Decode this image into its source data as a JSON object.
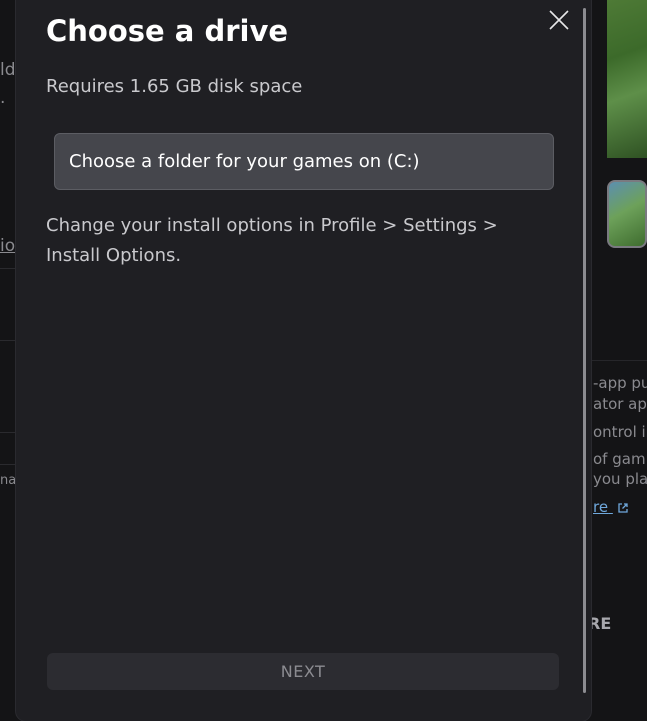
{
  "dialog": {
    "title": "Choose a drive",
    "space_requirement": "Requires 1.65 GB disk space",
    "folder_option": "Choose a folder for your games on (C:)",
    "info": "Change your install options in Profile > Settings > Install Options.",
    "next_label": "NEXT",
    "close_icon": "close-icon"
  },
  "background": {
    "left_fragments": [
      "ld",
      "io",
      "na"
    ],
    "right_fragments": [
      "-app pu",
      "ator app",
      "ontrol in",
      "of gam",
      "you pla",
      "re",
      "RE"
    ]
  },
  "colors": {
    "dialog_bg": "#1f1f23",
    "select_bg": "#45464c",
    "button_bg": "#2c2c31",
    "title": "#ffffff",
    "body_text": "#c9c9cd"
  }
}
